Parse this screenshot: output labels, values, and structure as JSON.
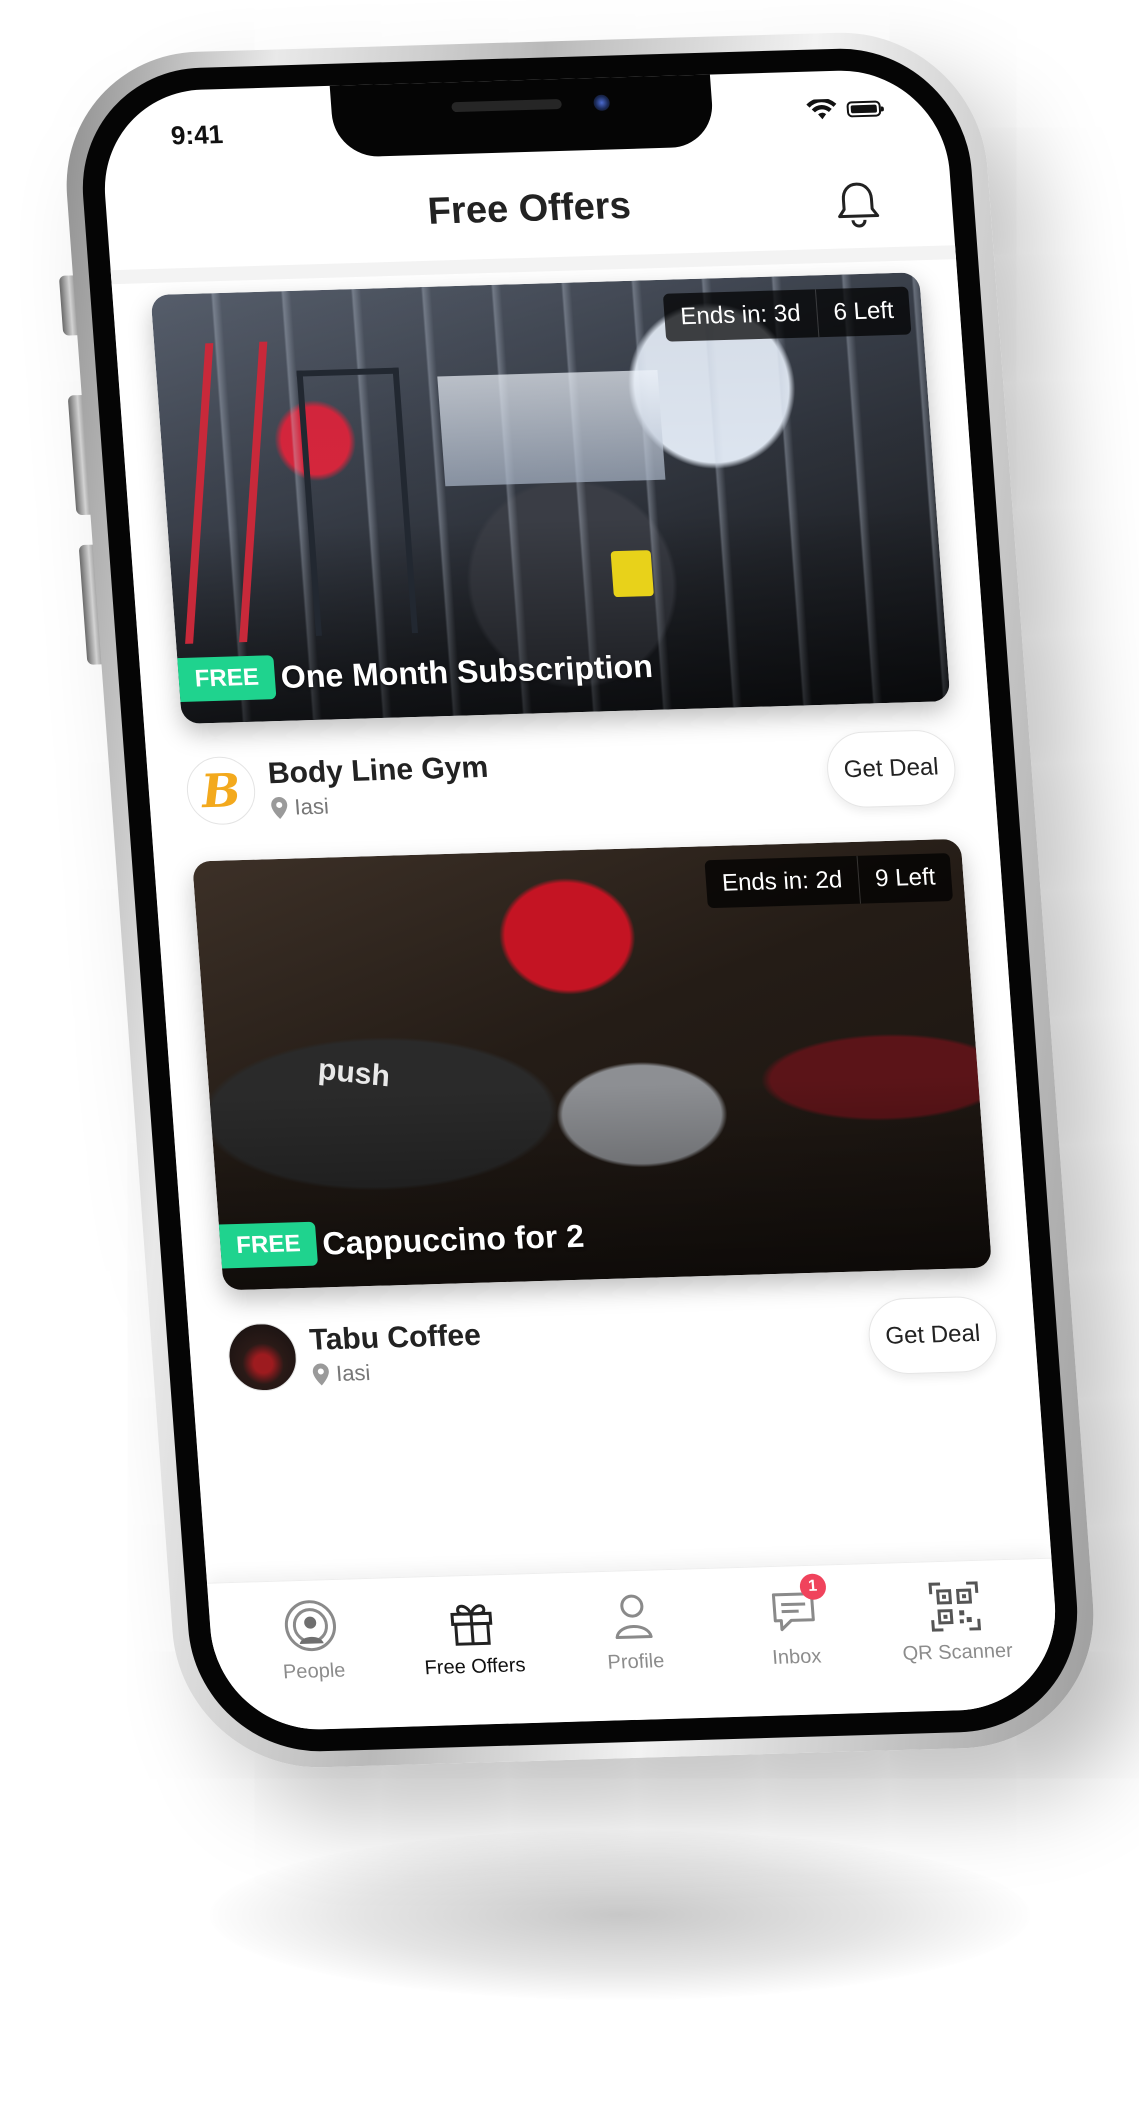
{
  "status": {
    "time": "9:41",
    "battery_level": 1.0
  },
  "header": {
    "title": "Free Offers",
    "right_icon": "bell-icon"
  },
  "offers": [
    {
      "ends_in": "Ends in: 3d",
      "left": "6 Left",
      "badge": "FREE",
      "title": "One Month Subscription",
      "merchant": {
        "name": "Body Line Gym",
        "logo_letter": "B",
        "location": "Iasi"
      },
      "button_label": "Get Deal"
    },
    {
      "ends_in": "Ends in: 2d",
      "left": "9 Left",
      "badge": "FREE",
      "title": "Cappuccino for 2",
      "cup_text": "push",
      "merchant": {
        "name": "Tabu Coffee",
        "location": "Iasi"
      },
      "button_label": "Get Deal"
    }
  ],
  "tabbar": {
    "active": "Free Offers",
    "items": [
      {
        "label": "People",
        "icon": "people-radar-icon"
      },
      {
        "label": "Free Offers",
        "icon": "gift-icon"
      },
      {
        "label": "Profile",
        "icon": "profile-icon"
      },
      {
        "label": "Inbox",
        "icon": "chat-icon",
        "badge": "1"
      },
      {
        "label": "QR Scanner",
        "icon": "qr-code-icon"
      }
    ]
  },
  "colors": {
    "accent_free": "#1fd38e",
    "badge_red": "#f0435c",
    "logo_yellow": "#f3a91d"
  }
}
